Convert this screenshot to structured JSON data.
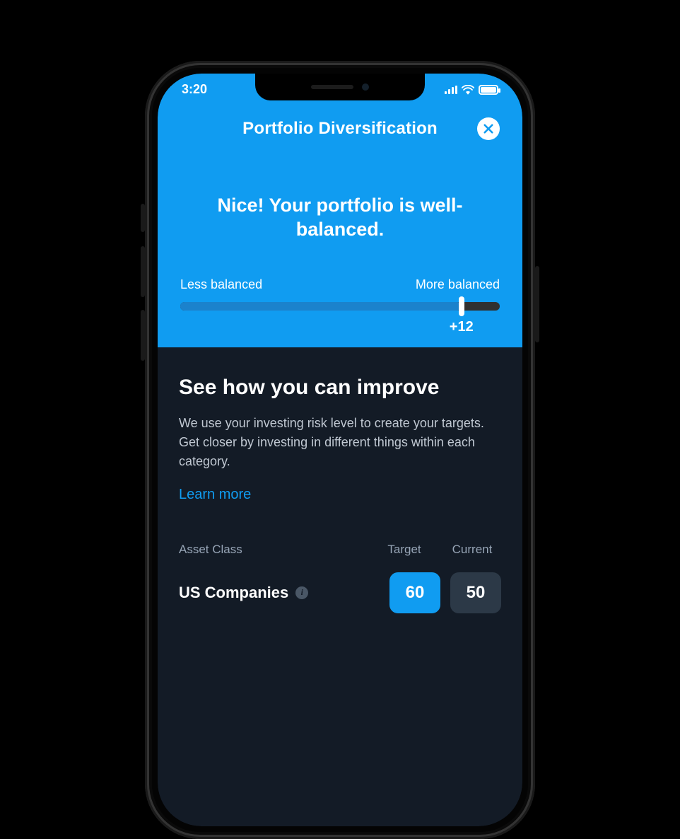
{
  "status": {
    "time": "3:20"
  },
  "header": {
    "title": "Portfolio Diversification"
  },
  "summary": {
    "headline": "Nice! Your portfolio is well-balanced."
  },
  "slider": {
    "left_label": "Less balanced",
    "right_label": "More balanced",
    "value_label": "+12",
    "percent": 88
  },
  "improve": {
    "title": "See how you can improve",
    "description": "We use your investing risk level to create your targets. Get closer by investing in different things within each category.",
    "learn_more": "Learn more"
  },
  "table": {
    "col_asset": "Asset Class",
    "col_target": "Target",
    "col_current": "Current",
    "rows": [
      {
        "name": "US Companies",
        "target": "60",
        "current": "50"
      }
    ]
  }
}
